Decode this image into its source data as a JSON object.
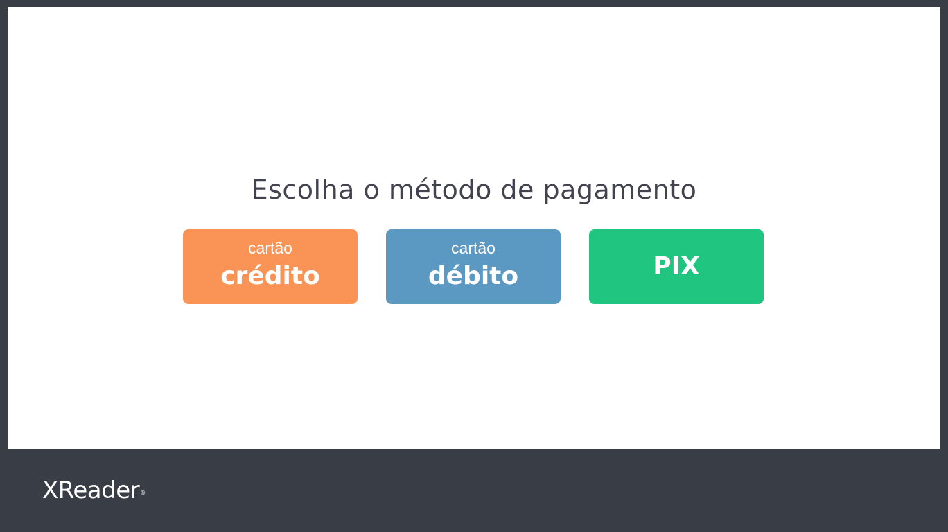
{
  "screen": {
    "title": "Escolha o método de pagamento"
  },
  "payment_options": [
    {
      "sub_label": "cartão",
      "label": "crédito",
      "color": "#f99456"
    },
    {
      "sub_label": "cartão",
      "label": "débito",
      "color": "#5b98c2"
    },
    {
      "sub_label": "",
      "label": "PIX",
      "color": "#20c67f"
    }
  ],
  "footer": {
    "logo_text": "XReader",
    "logo_mark": "®"
  },
  "colors": {
    "frame_background": "#393d45",
    "panel_background": "#ffffff",
    "title_text": "#43434f"
  }
}
